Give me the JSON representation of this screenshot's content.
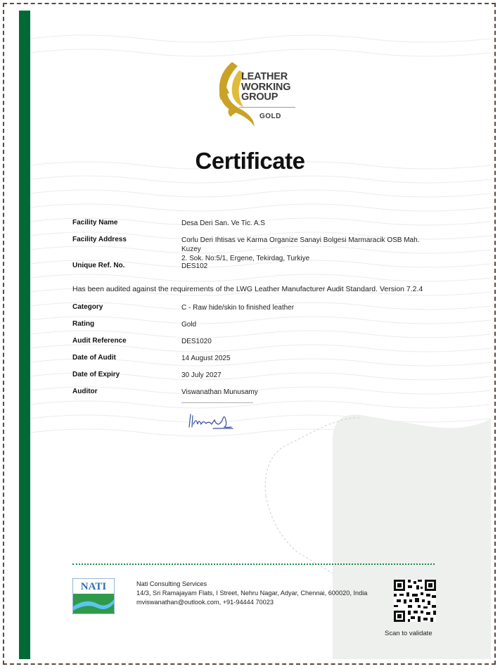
{
  "logo": {
    "line1": "LEATHER",
    "line2": "WORKING",
    "line3": "GROUP",
    "tier": "GOLD",
    "icon": "gold-leaf-icon"
  },
  "title": "Certificate",
  "facility": {
    "name_label": "Facility Name",
    "name_value": "Desa Deri San. Ve Tic. A.S",
    "address_label": "Facility Address",
    "address_line1": "Corlu Deri Ihtisas ve Karma Organize Sanayi Bolgesi Marmaracik OSB Mah. Kuzey",
    "address_line2": "2. Sok. No:5/1, Ergene, Tekirdag, Turkiye",
    "ref_label": "Unique Ref. No.",
    "ref_value": "DES102"
  },
  "statement": "Has been audited against the requirements of the LWG Leather Manufacturer Audit Standard. Version 7.2.4",
  "details": {
    "category_label": "Category",
    "category_value": "C - Raw hide/skin to finished leather",
    "rating_label": "Rating",
    "rating_value": "Gold",
    "audit_ref_label": "Audit Reference",
    "audit_ref_value": "DES1020",
    "date_audit_label": "Date of Audit",
    "date_audit_value": "14 August 2025",
    "date_expiry_label": "Date of Expiry",
    "date_expiry_value": "30 July 2027",
    "auditor_label": "Auditor",
    "auditor_value": "Viswanathan Munusamy"
  },
  "footer": {
    "nati_logo_text": "NATI",
    "company_name": "Nati Consulting Services",
    "address": "14/3, Sri Ramajayam Flats, I Street, Nehru Nagar, Adyar, Chennai, 600020, India",
    "contact": "mviswanathan@outlook.com, +91-94444 70023",
    "scan_label": "Scan to validate",
    "qr_icon": "qr-code-icon"
  },
  "colors": {
    "green_bar": "#006a37",
    "gold": "#c9a227",
    "dots": "#1e8a4a"
  }
}
